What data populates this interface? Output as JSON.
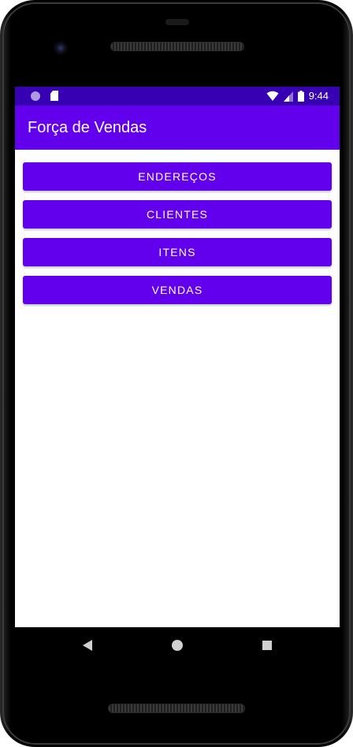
{
  "status_bar": {
    "time": "9:44",
    "icons": [
      "notification-dot-icon",
      "sd-card-icon",
      "wifi-icon",
      "signal-icon",
      "battery-icon"
    ]
  },
  "app_bar": {
    "title": "Força de Vendas"
  },
  "buttons": [
    {
      "label": "ENDEREÇOS"
    },
    {
      "label": "CLIENTES"
    },
    {
      "label": "ITENS"
    },
    {
      "label": "VENDAS"
    }
  ],
  "nav_bar": {
    "icons": [
      "back-icon",
      "home-icon",
      "recents-icon"
    ]
  },
  "colors": {
    "status_bar": "#3700b3",
    "primary": "#6200ee",
    "background": "#ffffff",
    "device": "#000000"
  }
}
